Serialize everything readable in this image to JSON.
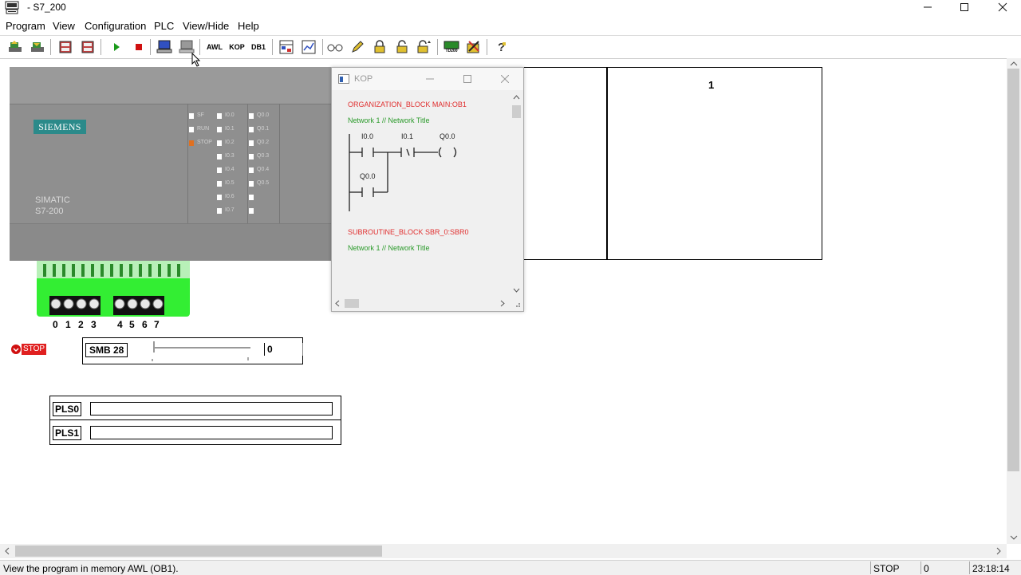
{
  "window": {
    "title": "- S7_200",
    "controls": [
      "minimize",
      "maximize",
      "close"
    ]
  },
  "menu": [
    "Program",
    "View",
    "Configuration",
    "PLC",
    "View/Hide",
    "Help"
  ],
  "toolbar": {
    "awl_label": "AWL",
    "kop_label": "KOP",
    "db1_label": "DB1",
    "td200_label": "TD200"
  },
  "plc": {
    "brand": "SIEMENS",
    "model_line1": "SIMATIC",
    "model_line2": "S7-200",
    "status_leds": [
      "SF",
      "RUN",
      "STOP"
    ],
    "inputs": [
      "I0.0",
      "I0.1",
      "I0.2",
      "I0.3",
      "I0.4",
      "I0.5",
      "I0.6",
      "I0.7"
    ],
    "outputs": [
      "Q0.0",
      "Q0.1",
      "Q0.2",
      "Q0.3",
      "Q0.4",
      "Q0.5"
    ],
    "active_status": "STOP",
    "status_color": "#e07020"
  },
  "terminal_numbers": [
    "0",
    "1",
    "2",
    "3",
    "4",
    "5",
    "6",
    "7"
  ],
  "stop_badge": "STOP",
  "smb": {
    "label": "SMB 28",
    "value": "0"
  },
  "pls": {
    "pls0": "PLS0",
    "pls1": "PLS1"
  },
  "panel_b": {
    "number": "1"
  },
  "kop": {
    "title": "KOP",
    "block1": "ORGANIZATION_BLOCK MAIN:OB1",
    "network1": "Network 1 // Network Title",
    "contact1": "I0.0",
    "contact2": "I0.1",
    "coil": "Q0.0",
    "parallel_contact": "Q0.0",
    "block2": "SUBROUTINE_BLOCK SBR_0:SBR0",
    "network2": "Network 1 // Network Title"
  },
  "status_bar": {
    "message": "View the program in memory AWL (OB1).",
    "state": "STOP",
    "value": "0",
    "time": "23:18:14"
  },
  "colors": {
    "terminal_green": "#33ee33",
    "siemens_teal": "#2b8a8a",
    "kop_red": "#e03030",
    "kop_green": "#2a9a2a"
  }
}
